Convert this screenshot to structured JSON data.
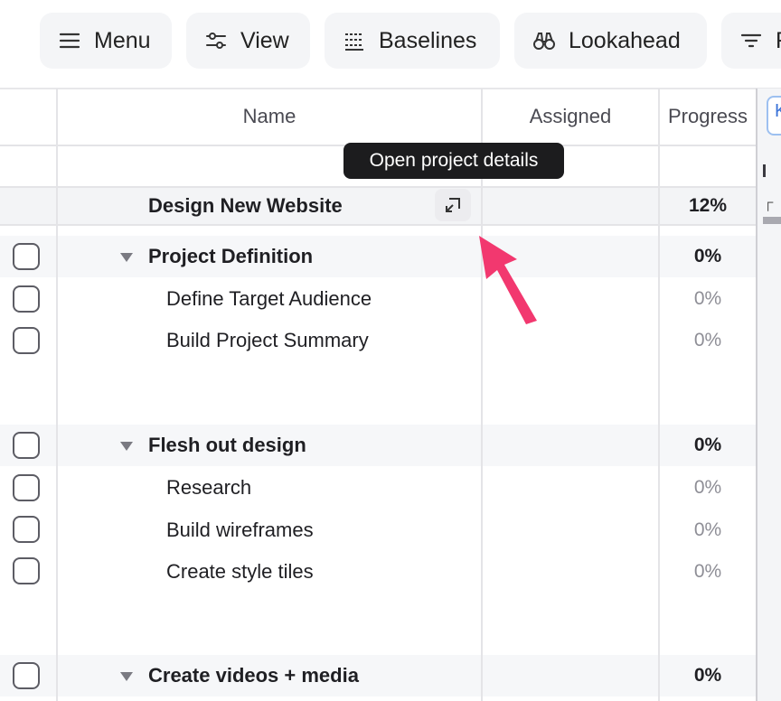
{
  "toolbar": {
    "menu_label": "Menu",
    "view_label": "View",
    "baselines_label": "Baselines",
    "lookahead_label": "Lookahead",
    "filter_label": "F"
  },
  "table": {
    "headers": {
      "name": "Name",
      "assigned": "Assigned",
      "progress": "Progress"
    },
    "project": {
      "name": "Design New Website",
      "progress": "12%"
    },
    "groups": [
      {
        "name": "Project Definition",
        "progress": "0%",
        "tasks": [
          {
            "name": "Define Target Audience",
            "progress": "0%"
          },
          {
            "name": "Build Project Summary",
            "progress": "0%"
          }
        ]
      },
      {
        "name": "Flesh out design",
        "progress": "0%",
        "tasks": [
          {
            "name": "Research",
            "progress": "0%"
          },
          {
            "name": "Build wireframes",
            "progress": "0%"
          },
          {
            "name": "Create style tiles",
            "progress": "0%"
          }
        ]
      },
      {
        "name": "Create videos + media",
        "progress": "0%",
        "tasks": []
      }
    ]
  },
  "tooltip": {
    "text": "Open project details"
  },
  "side_panel": {
    "tab_glyph": "K"
  },
  "colors": {
    "accent_arrow": "#f2386f",
    "tooltip_bg": "#1c1c1e",
    "toolbar_btn_bg": "#f4f5f7"
  }
}
